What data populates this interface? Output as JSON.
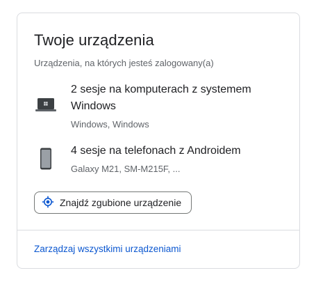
{
  "card": {
    "title": "Twoje urządzenia",
    "subtitle": "Urządzenia, na których jesteś zalogowany(a)"
  },
  "devices": [
    {
      "icon": "laptop-icon",
      "name": "2 sesje na komputerach z systemem Windows",
      "detail": "Windows, Windows"
    },
    {
      "icon": "phone-icon",
      "name": "4 sesje na telefonach z Androidem",
      "detail": "Galaxy M21, SM-M215F, ..."
    }
  ],
  "find_button": {
    "icon": "location-target-icon",
    "label": "Znajdź zgubione urządzenie"
  },
  "manage_link": "Zarządzaj wszystkimi urządzeniami",
  "colors": {
    "link": "#0b57d0",
    "secondary_text": "#5f6368",
    "border": "#dadce0"
  }
}
